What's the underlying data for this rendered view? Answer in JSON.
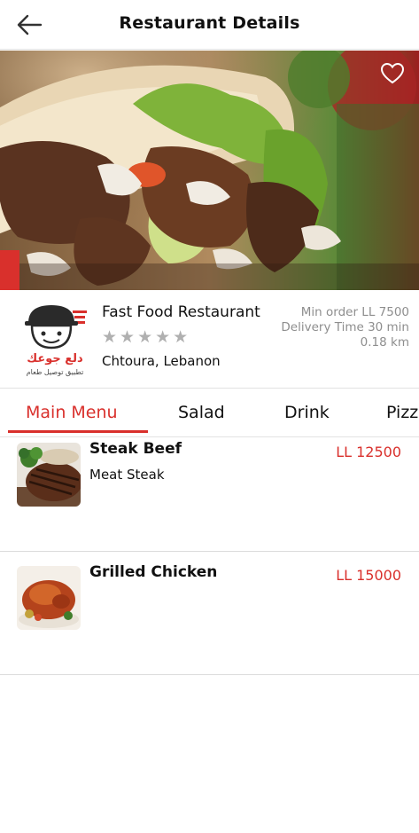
{
  "header": {
    "title": "Restaurant Details",
    "back_icon": "arrow-left-icon"
  },
  "hero": {
    "image": "shawarma wrap with grilled beef, lettuce and garlic sauce",
    "favorite_icon": "heart-outline-icon"
  },
  "restaurant": {
    "logo_icon": "restaurant-logo-chef-hat-face",
    "logo_text_arabic": "دلع جوعك",
    "logo_tagline_arabic": "تطبيق توصيل طعام",
    "name": "Fast Food Restaurant",
    "rating_stars": "★★★★★",
    "rating_value": 0,
    "rating_max": 5,
    "location": "Chtoura, Lebanon",
    "min_order": "Min order LL 7500",
    "delivery_time": "Delivery Time 30 min",
    "distance": "0.18 km"
  },
  "tabs": [
    {
      "label": "Main Menu",
      "active": true
    },
    {
      "label": "Salad",
      "active": false
    },
    {
      "label": "Drink",
      "active": false
    },
    {
      "label": "Pizza",
      "active": false
    }
  ],
  "menu_items": [
    {
      "name": "Steak Beef",
      "description": "Meat Steak",
      "price": "LL 12500",
      "image": "steak-beef-thumbnail"
    },
    {
      "name": "Grilled Chicken",
      "description": "",
      "price": "LL 15000",
      "image": "grilled-chicken-thumbnail"
    }
  ],
  "colors": {
    "accent": "#d9302c",
    "text": "#111111",
    "muted": "#8e8e8e",
    "stars": "#b0b0b0",
    "divider": "#e2e2e2"
  }
}
